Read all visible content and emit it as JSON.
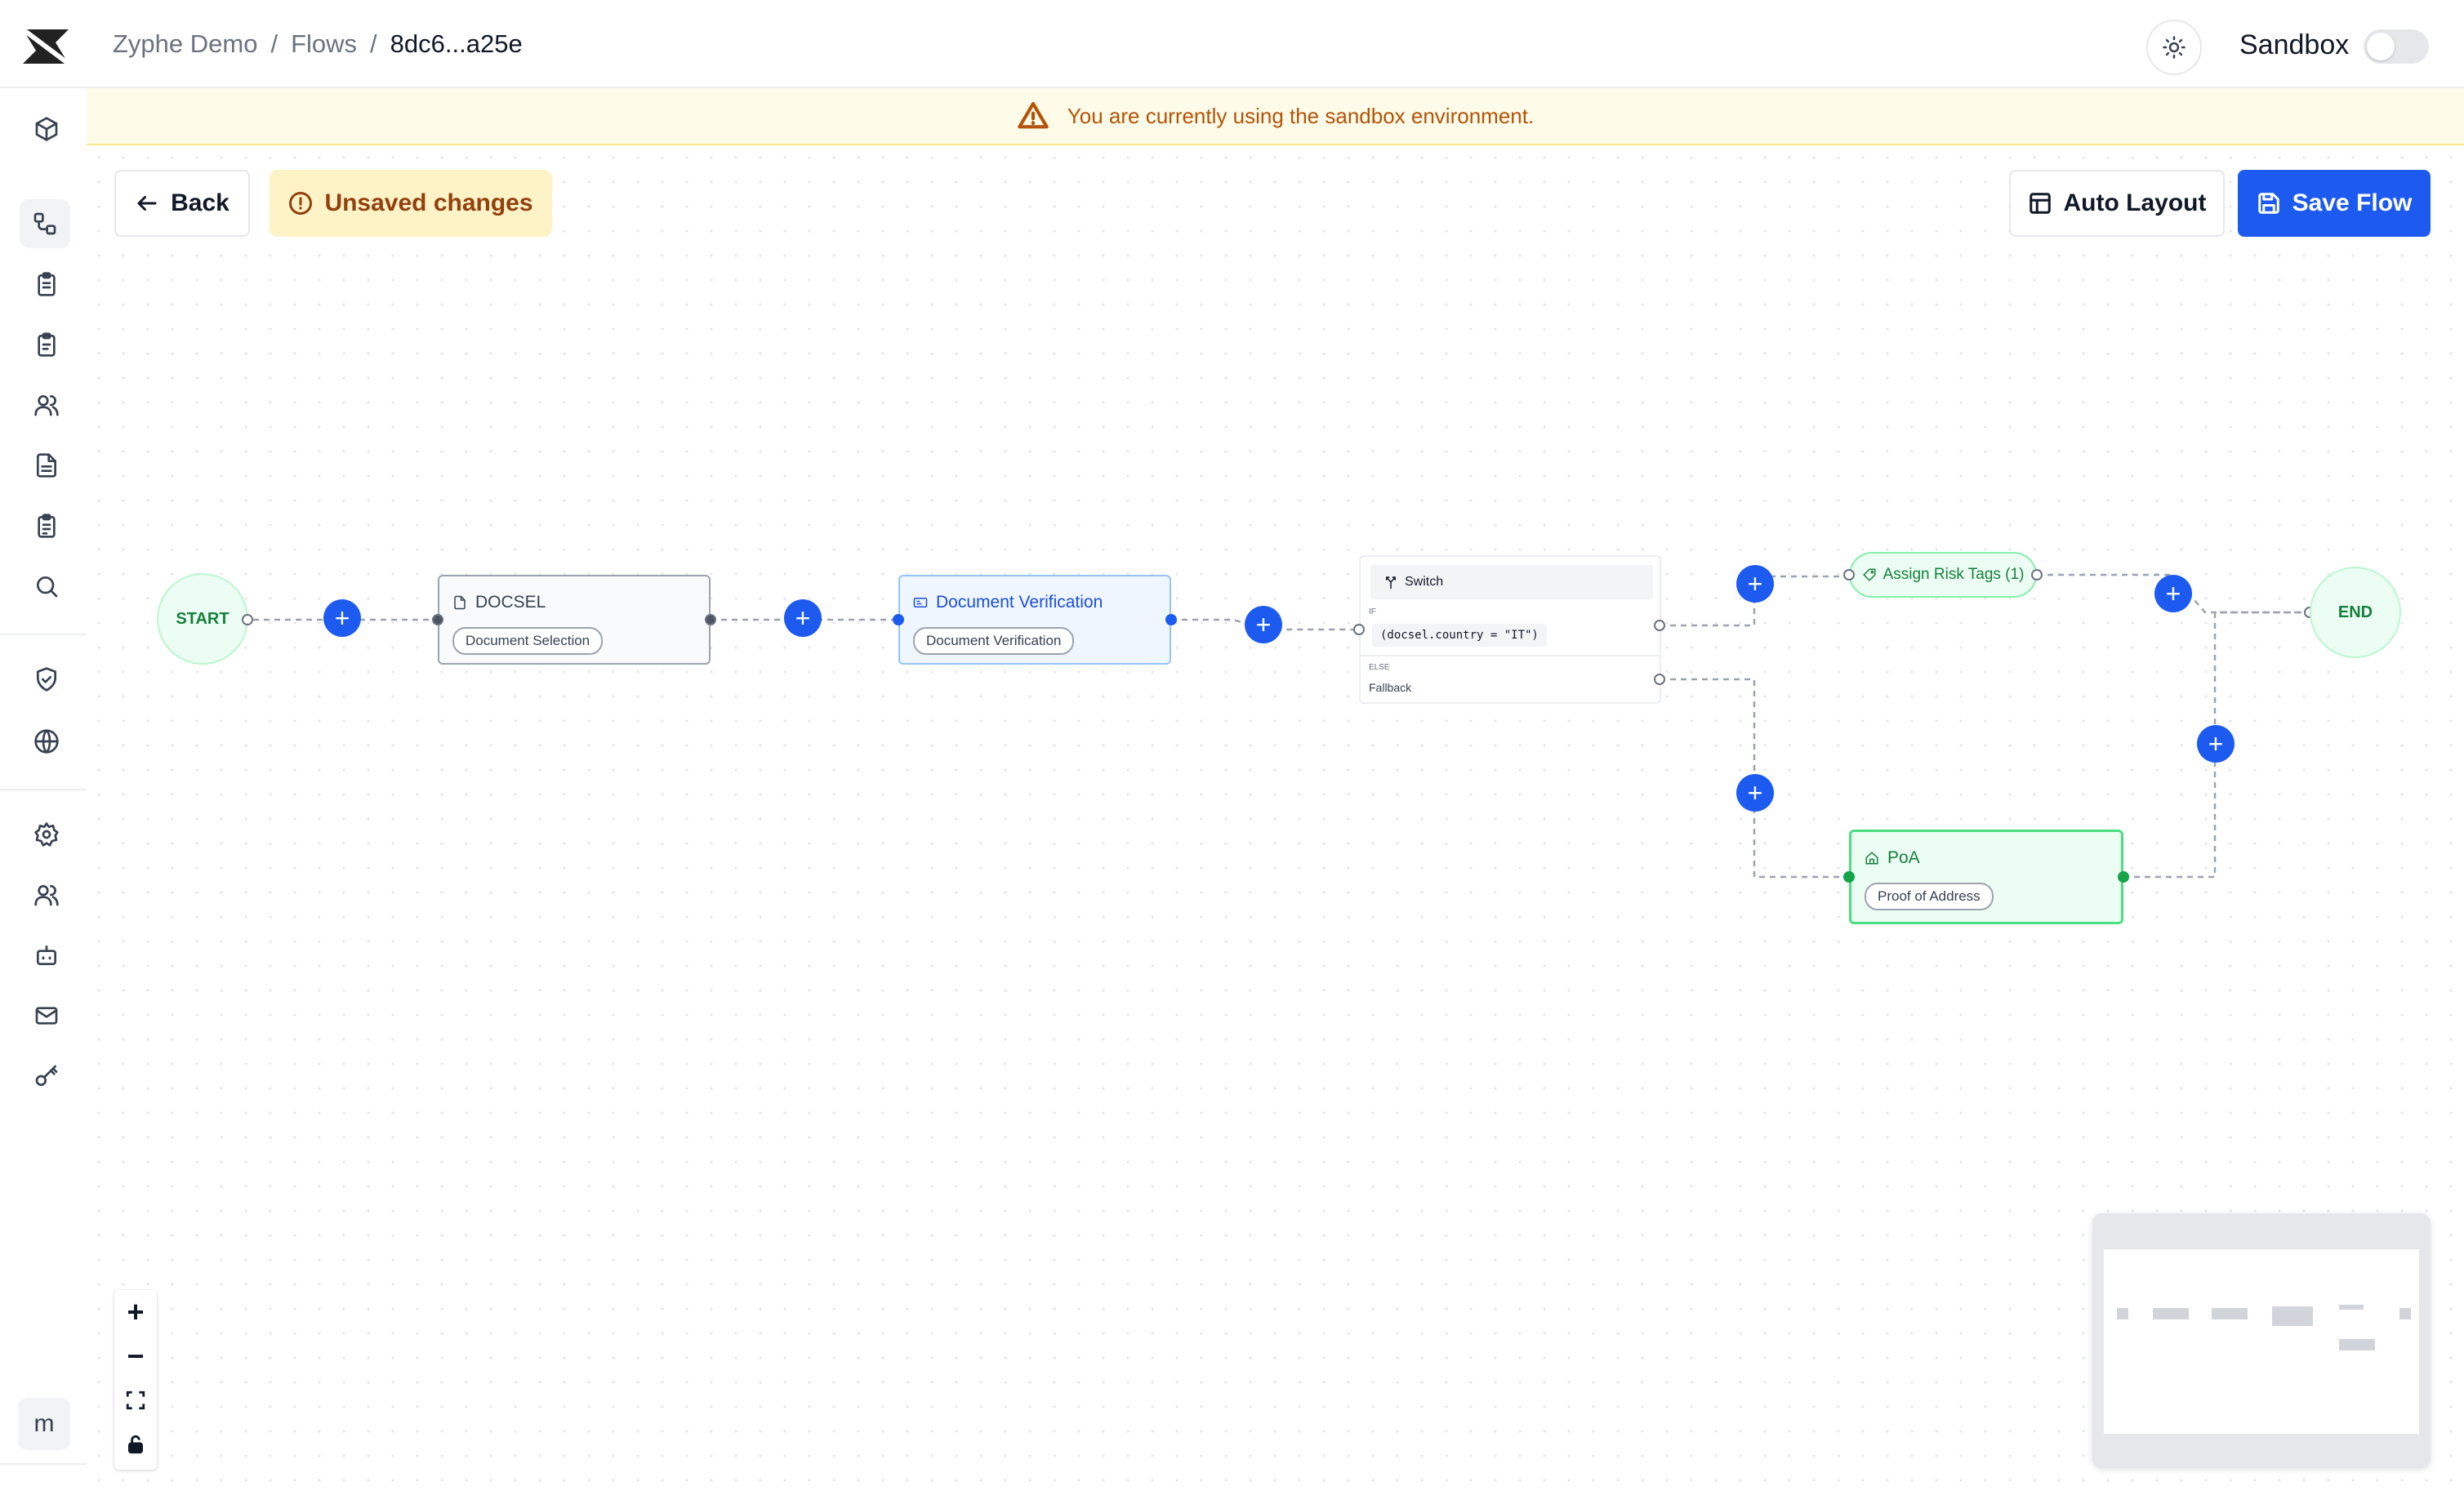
{
  "app": {
    "logo": "zyphe-logo"
  },
  "breadcrumb": {
    "org": "Zyphe Demo",
    "section": "Flows",
    "flow_id": "8dc6...a25e",
    "separator": "/"
  },
  "header": {
    "theme_icon": "sun-icon",
    "sandbox_label": "Sandbox",
    "sandbox_enabled": false
  },
  "banner": {
    "icon": "warning-triangle-icon",
    "text": "You are currently using the sandbox environment."
  },
  "toolbar": {
    "back_label": "Back",
    "unsaved_label": "Unsaved changes",
    "auto_layout_label": "Auto Layout",
    "save_label": "Save Flow"
  },
  "sidebar": {
    "items": [
      {
        "name": "box-icon"
      },
      {
        "name": "flows-icon",
        "active": true
      },
      {
        "name": "clipboard-icon"
      },
      {
        "name": "clipboard-check-icon"
      },
      {
        "name": "users-icon"
      },
      {
        "name": "document-icon"
      },
      {
        "name": "clipboard-list-icon"
      },
      {
        "name": "search-icon"
      },
      {
        "name": "shield-check-icon"
      },
      {
        "name": "globe-icon"
      },
      {
        "name": "gear-icon"
      },
      {
        "name": "team-icon"
      },
      {
        "name": "bot-icon"
      },
      {
        "name": "mail-icon"
      },
      {
        "name": "key-icon"
      }
    ],
    "avatar_initial": "m"
  },
  "flow": {
    "start_label": "START",
    "end_label": "END",
    "add_symbol": "+",
    "nodes": {
      "docsel": {
        "title": "DOCSEL",
        "subtitle": "Document Selection"
      },
      "docver": {
        "title": "Document Verification",
        "subtitle": "Document Verification"
      },
      "switch": {
        "title": "Switch",
        "if_label": "IF",
        "condition": "(docsel.country = \"IT\")",
        "else_label": "ELSE",
        "else_value": "Fallback"
      },
      "tags": {
        "title": "Assign Risk Tags (1)"
      },
      "poa": {
        "title": "PoA",
        "subtitle": "Proof of Address"
      }
    }
  },
  "zoom_controls": {
    "zoom_in": "+",
    "zoom_out": "−"
  },
  "colors": {
    "primary": "#1d5bf0",
    "warning": "#b45309",
    "success": "#15803d"
  }
}
